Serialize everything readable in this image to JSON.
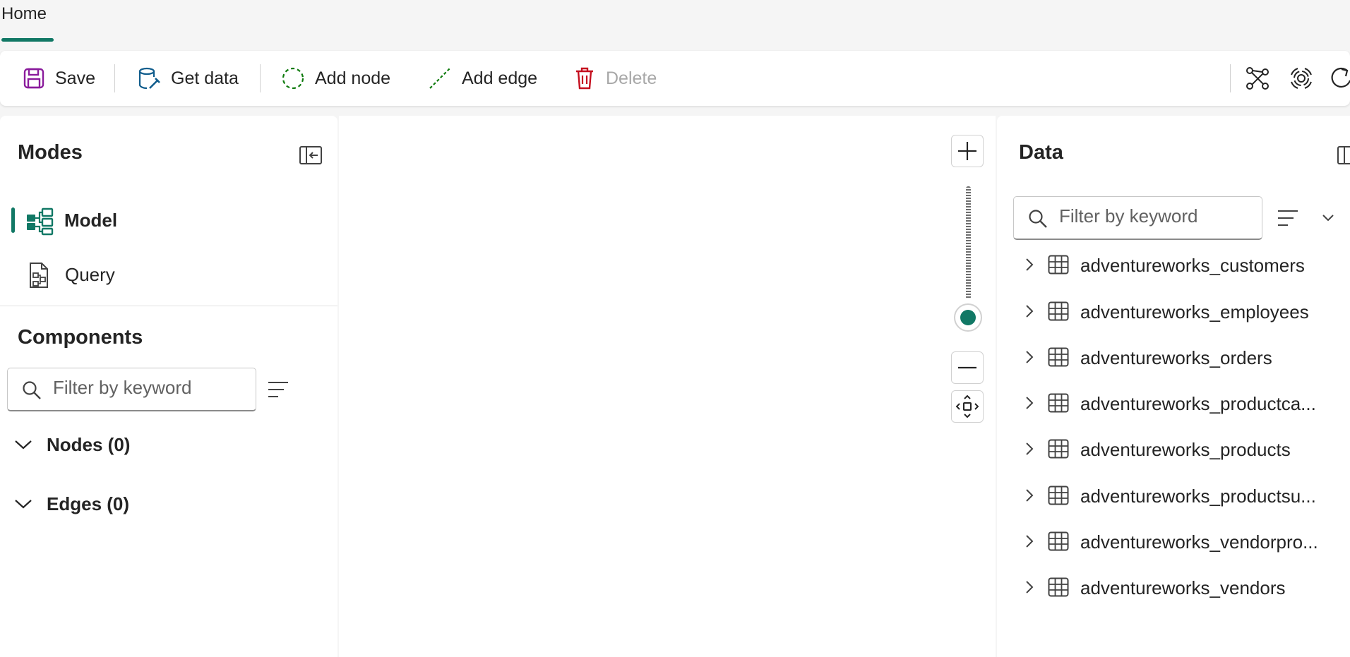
{
  "tabs": {
    "home": "Home"
  },
  "ribbon": {
    "save": "Save",
    "get_data": "Get data",
    "add_node": "Add node",
    "add_edge": "Add edge",
    "delete": "Delete"
  },
  "modes": {
    "title": "Modes",
    "items": [
      {
        "label": "Model",
        "selected": true,
        "icon": "model-icon"
      },
      {
        "label": "Query",
        "selected": false,
        "icon": "query-icon"
      }
    ]
  },
  "components": {
    "title": "Components",
    "filter_placeholder": "Filter by keyword",
    "groups": [
      {
        "label": "Nodes (0)"
      },
      {
        "label": "Edges (0)"
      }
    ]
  },
  "data_panel": {
    "title": "Data",
    "filter_placeholder": "Filter by keyword",
    "tables": [
      "adventureworks_customers",
      "adventureworks_employees",
      "adventureworks_orders",
      "adventureworks_productca...",
      "adventureworks_products",
      "adventureworks_productsu...",
      "adventureworks_vendorpro...",
      "adventureworks_vendors"
    ]
  },
  "colors": {
    "accent": "#117865",
    "save_icon": "#8a1b9c",
    "delete_icon": "#c50f1f",
    "add_icon": "#0e7a0d",
    "get_data_icon": "#0f5c8c"
  }
}
